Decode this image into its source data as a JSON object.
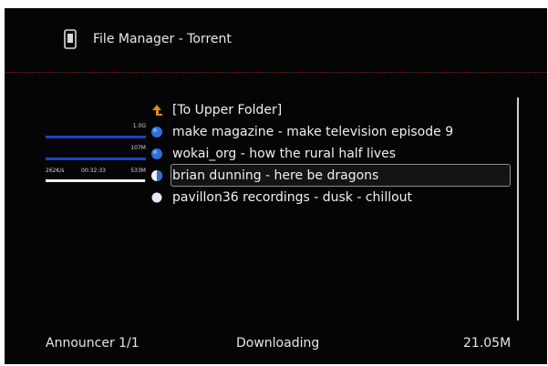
{
  "header": {
    "title": "File Manager - Torrent",
    "icon": "torrent-file-icon"
  },
  "items": [
    {
      "label": "[To Upper Folder]",
      "icon": "upper-folder-arrow-icon"
    },
    {
      "label": "make magazine - make television episode 9",
      "icon": "download-status-icon",
      "size": "1.0G",
      "progress": 1.0
    },
    {
      "label": "wokai_org - how the rural half lives",
      "icon": "download-status-icon",
      "size": "107M",
      "progress": 1.0
    },
    {
      "label": "brian dunning - here be dragons",
      "icon": "partial-download-icon",
      "speed": "262K/s",
      "eta": "00:32:33",
      "size": "533M",
      "progress": 0.99,
      "selected": true
    },
    {
      "label": "pavillon36 recordings - dusk - chillout",
      "icon": "queued-icon"
    }
  ],
  "footer": {
    "announcer": "Announcer 1/1",
    "status": "Downloading",
    "total": "21.05M"
  },
  "colors": {
    "accent": "#e08a1e",
    "bar": "#1e3fd0",
    "progress": "#f2f2f2",
    "divider": "#8a2222"
  }
}
